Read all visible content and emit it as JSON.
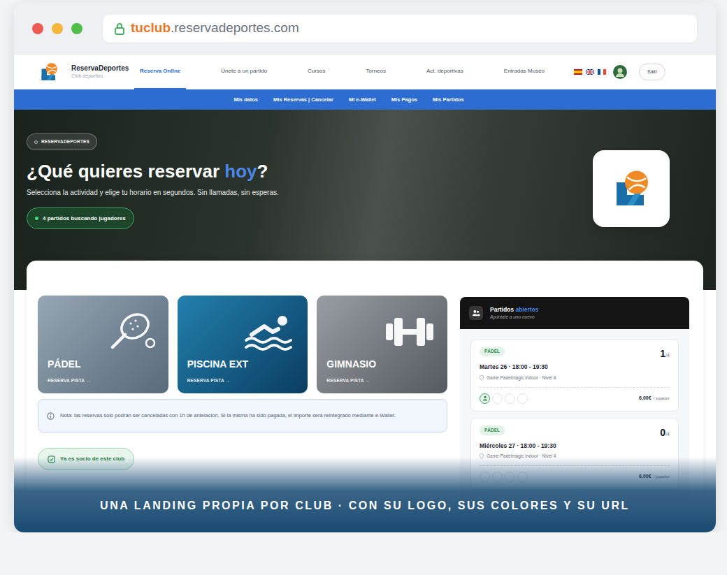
{
  "browser": {
    "url_subdomain": "tuclub",
    "url_domain": ".reservadeportes.com"
  },
  "brand": {
    "name": "ReservaDeportes",
    "subtitle": "Club deportivo"
  },
  "nav": [
    {
      "label": "Reserva Online",
      "selected": true
    },
    {
      "label": "Únete a un partido",
      "selected": false
    },
    {
      "label": "Cursos",
      "selected": false
    },
    {
      "label": "Torneos",
      "selected": false
    },
    {
      "label": "Act. deportivas",
      "selected": false
    },
    {
      "label": "Entradas Museo",
      "selected": false
    }
  ],
  "flags": [
    {
      "kind": "es"
    },
    {
      "kind": "en"
    },
    {
      "kind": "fr"
    }
  ],
  "logout": "Salir",
  "subnav": [
    "Mis datos",
    "Mis Reservas | Cancelar",
    "Mi e-Wallet",
    "Mis Pagos",
    "Mis Partidos"
  ],
  "hero": {
    "badge": "RESERVADEPORTES",
    "heading_before": "¿Qué quieres reservar ",
    "heading_highlight": "hoy",
    "heading_after": "?",
    "subtitle": "Selecciona la actividad y elige tu horario en segundos. Sin llamadas, sin esperas.",
    "pill": "4 partidos buscando jugadores"
  },
  "activities": [
    {
      "title": "PÁDEL",
      "action": "RESERVA PISTA →",
      "kind": "padel"
    },
    {
      "title": "PISCINA EXT",
      "action": "RESERVA PISTA →",
      "kind": "swim"
    },
    {
      "title": "GIMNASIO",
      "action": "RESERVA PISTA →",
      "kind": "gym"
    }
  ],
  "note": "Nota: las reservas solo podrán ser canceladas con 1h de antelación. Si la misma ha sido pagada, el importe será reintegrado mediante e-Wallet.",
  "member_button": "Ya es socio de este club",
  "matches": {
    "title_before": "Partidos ",
    "title_highlight": "abiertos",
    "subtitle": "Apúntate a uno nuevo",
    "items": [
      {
        "sport": "PÁDEL",
        "date": "Martes 26 · 18:00 - 19:30",
        "venue": "Game Padelmagic Indoor · Nivel 4",
        "count": "1",
        "capacity": "/4",
        "slots": [
          true,
          false,
          false,
          false
        ],
        "price": "6,00€",
        "unit": "/ jugador"
      },
      {
        "sport": "PÁDEL",
        "date": "Miércoles 27 · 18:00 - 19:30",
        "venue": "Game Padelmagic Indoor · Nivel 4",
        "count": "0",
        "capacity": "/4",
        "slots": [
          false,
          false,
          false,
          false
        ],
        "price": "6,00€",
        "unit": "/ jugador"
      }
    ]
  },
  "caption": "UNA LANDING PROPIA POR CLUB · CON SU LOGO, SUS COLORES Y SU URL"
}
